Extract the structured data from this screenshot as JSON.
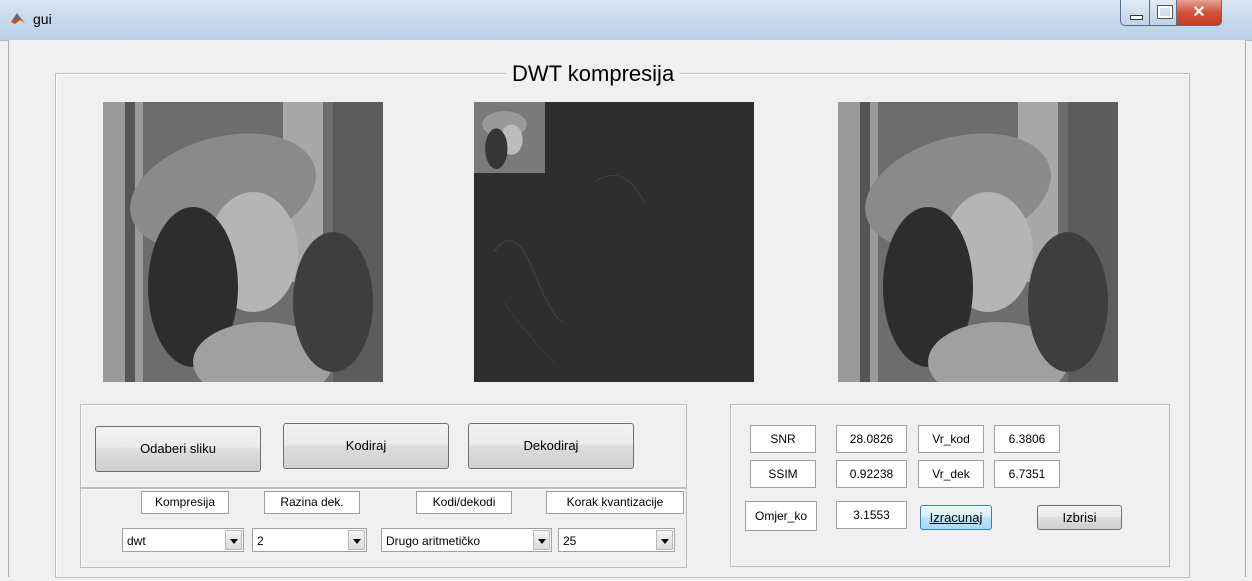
{
  "window": {
    "title": "gui",
    "icon": "matlab-icon"
  },
  "panel": {
    "title": "DWT kompresija"
  },
  "images": [
    {
      "name": "original-image"
    },
    {
      "name": "dwt-coefficients-image"
    },
    {
      "name": "decoded-image"
    }
  ],
  "buttons": {
    "odaberi": "Odaberi sliku",
    "kodiraj": "Kodiraj",
    "dekodiraj": "Dekodiraj",
    "izracunaj": "Izracunaj",
    "izbrisi": "Izbrisi"
  },
  "labels": {
    "kompresija": "Kompresija",
    "razina": "Razina dek.",
    "kodi": "Kodi/dekodi",
    "korak": "Korak kvantizacije",
    "snr": "SNR",
    "ssim": "SSIM",
    "omjer": "Omjer_ko",
    "vr_kod": "Vr_kod",
    "vr_dek": "Vr_dek"
  },
  "selects": {
    "kompresija": "dwt",
    "razina": "2",
    "kodi": "Drugo aritmetičko",
    "korak": "25"
  },
  "values": {
    "snr": "28.0826",
    "ssim": "0.92238",
    "omjer": "3.1553",
    "vr_kod": "6.3806",
    "vr_dek": "6.7351"
  }
}
